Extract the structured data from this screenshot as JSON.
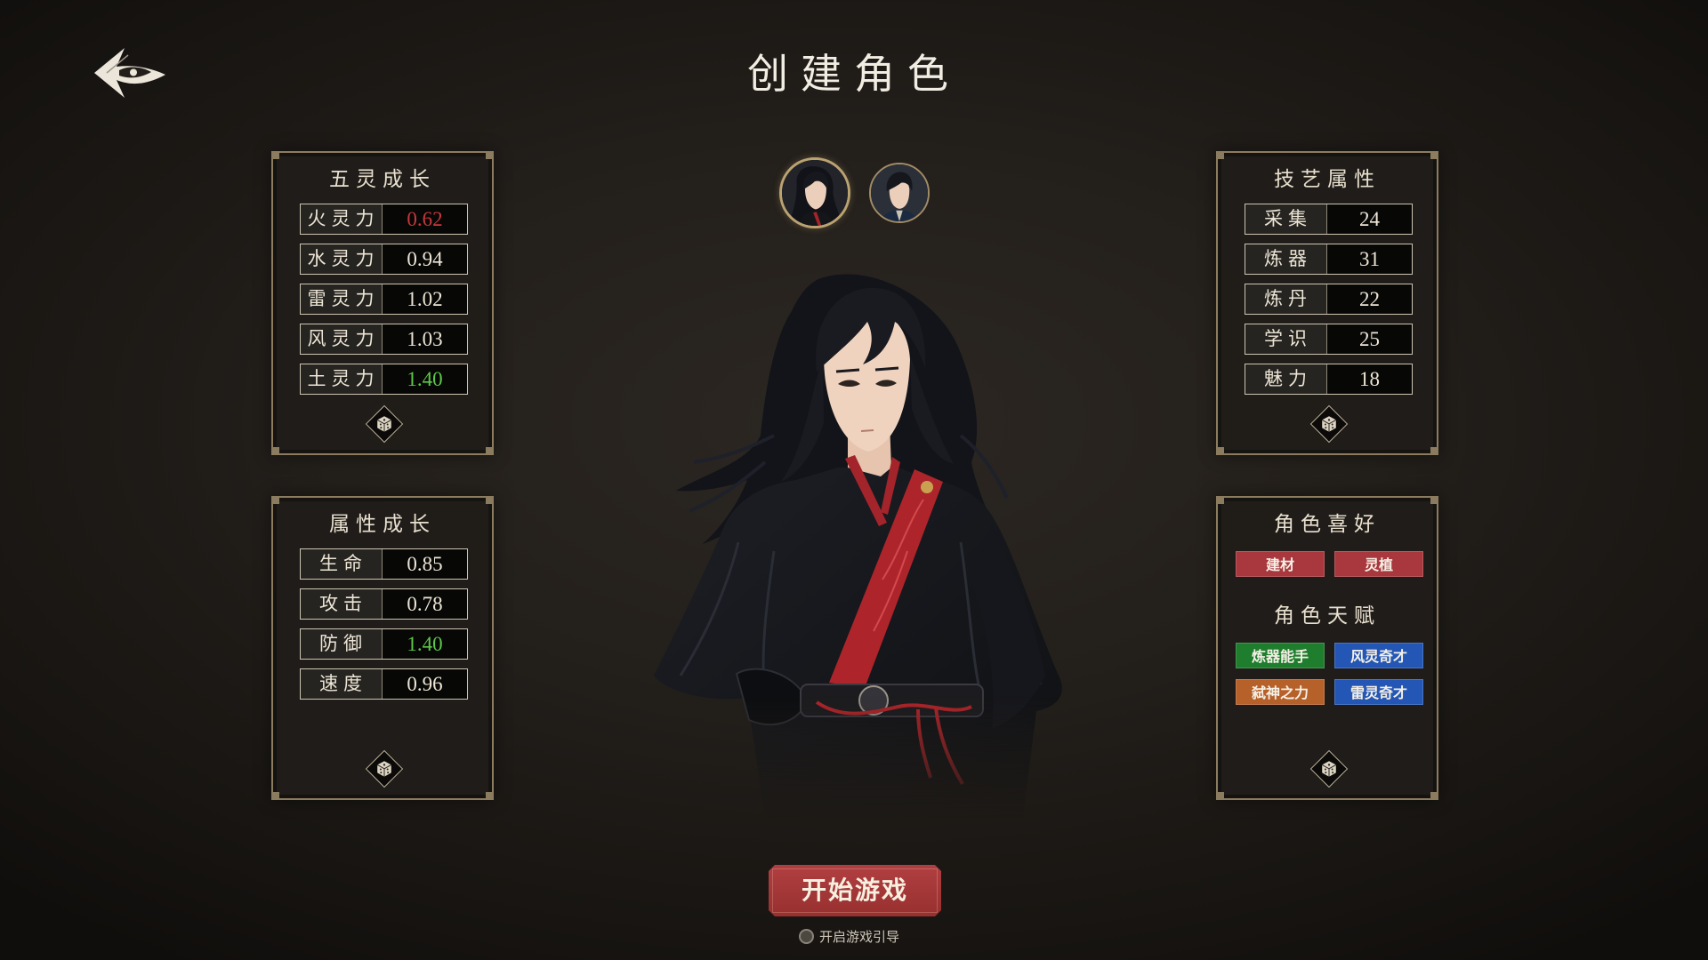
{
  "page": {
    "title": "创建角色"
  },
  "back_button": {
    "icon": "back-arrow-icon"
  },
  "colors": {
    "panel_border": "#8c7c5f",
    "start_button": "#a3373a"
  },
  "portraits": [
    {
      "icon": "portrait-long-hair-icon",
      "selected": true
    },
    {
      "icon": "portrait-short-hair-icon",
      "selected": false
    }
  ],
  "five_spirit": {
    "title": "五灵成长",
    "rows": [
      {
        "label": "火灵力",
        "value": "0.62",
        "color": "#c8373c"
      },
      {
        "label": "水灵力",
        "value": "0.94",
        "color": "#ede6d6"
      },
      {
        "label": "雷灵力",
        "value": "1.02",
        "color": "#ede6d6"
      },
      {
        "label": "风灵力",
        "value": "1.03",
        "color": "#ede6d6"
      },
      {
        "label": "土灵力",
        "value": "1.40",
        "color": "#5dc848"
      }
    ],
    "reroll_icon": "dice-icon"
  },
  "attribute_growth": {
    "title": "属性成长",
    "rows": [
      {
        "label": "生命",
        "value": "0.85",
        "color": "#ede6d6"
      },
      {
        "label": "攻击",
        "value": "0.78",
        "color": "#ede6d6"
      },
      {
        "label": "防御",
        "value": "1.40",
        "color": "#5dc848"
      },
      {
        "label": "速度",
        "value": "0.96",
        "color": "#ede6d6"
      }
    ],
    "reroll_icon": "dice-icon"
  },
  "craft_attributes": {
    "title": "技艺属性",
    "rows": [
      {
        "label": "采集",
        "value": "24",
        "color": "#ede6d6"
      },
      {
        "label": "炼器",
        "value": "31",
        "color": "#ede6d6"
      },
      {
        "label": "炼丹",
        "value": "22",
        "color": "#ede6d6"
      },
      {
        "label": "学识",
        "value": "25",
        "color": "#ede6d6"
      },
      {
        "label": "魅力",
        "value": "18",
        "color": "#ede6d6"
      }
    ],
    "reroll_icon": "dice-icon"
  },
  "traits_panel": {
    "preferences": {
      "title": "角色喜好",
      "tags": [
        {
          "label": "建材",
          "color": "#a8383e"
        },
        {
          "label": "灵植",
          "color": "#a8383e"
        }
      ]
    },
    "talents": {
      "title": "角色天赋",
      "tags": [
        {
          "label": "炼器能手",
          "color": "#1f7d2e"
        },
        {
          "label": "风灵奇才",
          "color": "#2457b5"
        },
        {
          "label": "弑神之力",
          "color": "#b6602a"
        },
        {
          "label": "雷灵奇才",
          "color": "#2457b5"
        }
      ]
    },
    "reroll_icon": "dice-icon"
  },
  "start_button": {
    "label": "开始游戏"
  },
  "tutorial_toggle": {
    "label": "开启游戏引导",
    "checked": false
  }
}
